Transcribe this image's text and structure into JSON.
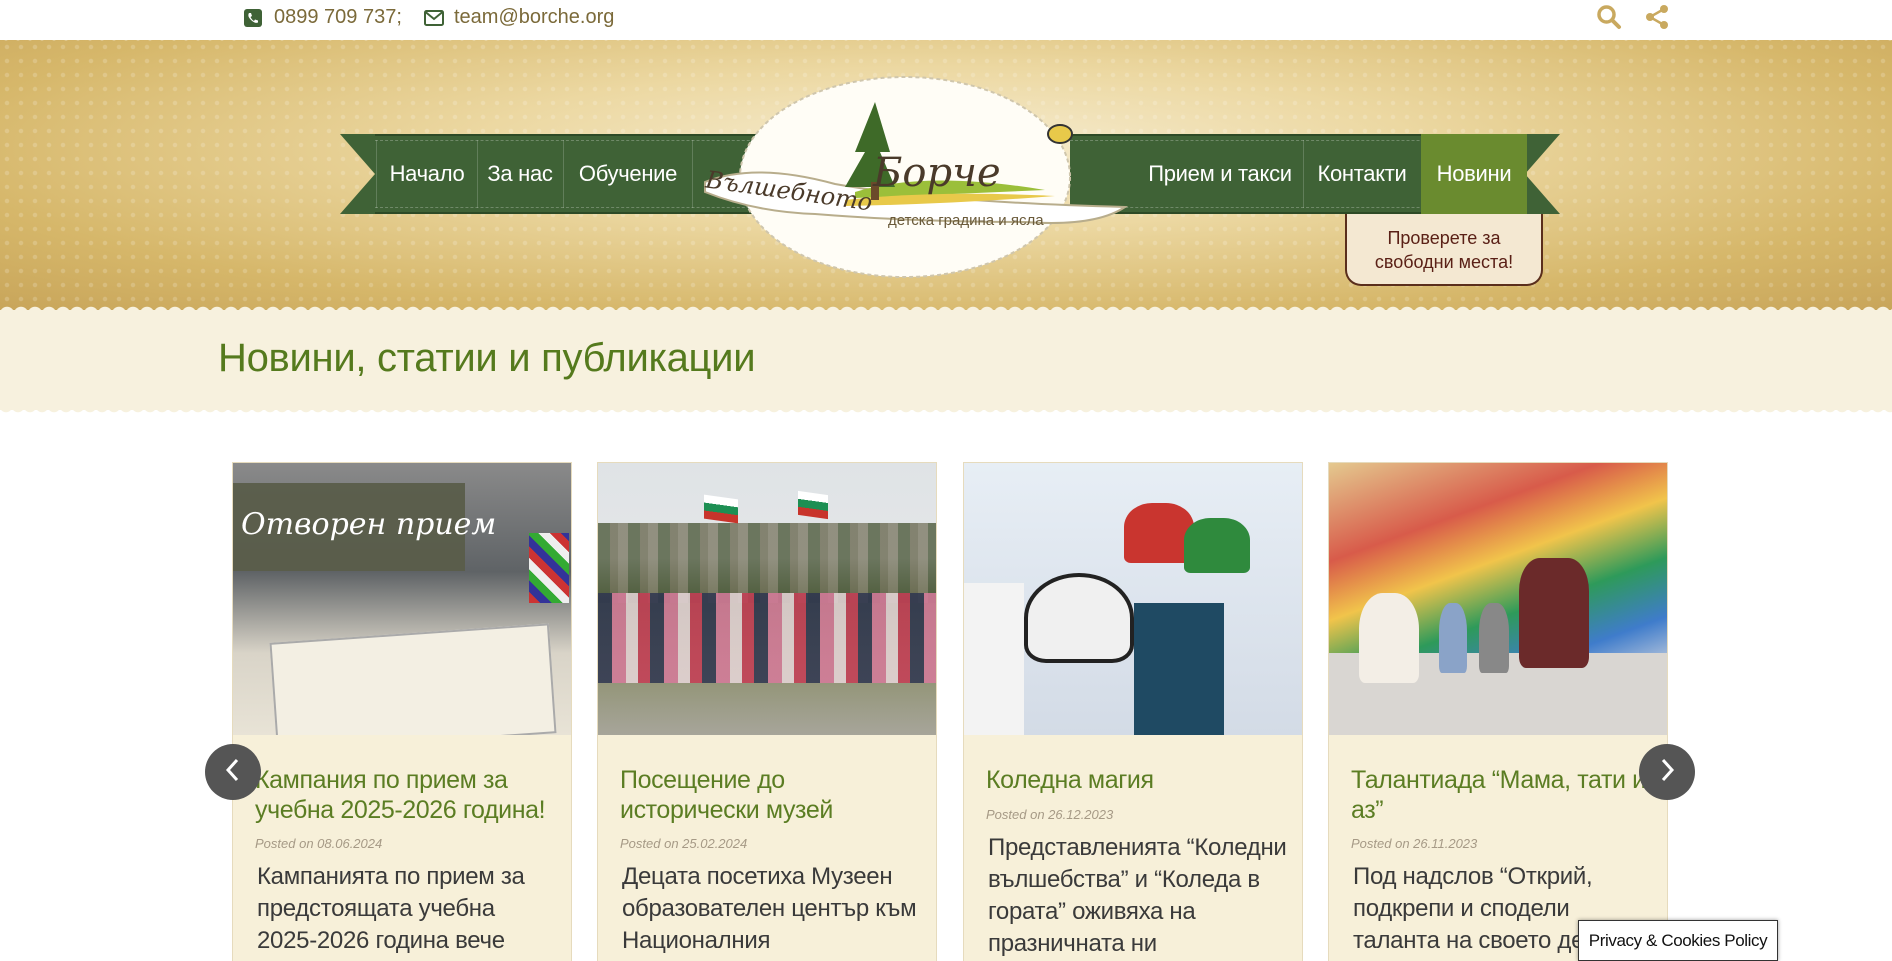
{
  "topbar": {
    "phone": "0899 709 737;",
    "email": "team@borche.org",
    "search_icon": "search-icon",
    "share_icon": "share-icon"
  },
  "nav": {
    "items": [
      {
        "label": "Начало"
      },
      {
        "label": "За нас"
      },
      {
        "label": "Обучение"
      },
      {
        "label": "Прием и такси"
      },
      {
        "label": "Контакти"
      },
      {
        "label": "Новини",
        "active": true
      }
    ],
    "cta": "Проверете за свободни места!"
  },
  "logo": {
    "name_script": "Вълшебното",
    "name_main": "Борче",
    "subtitle": "детска градина и ясла"
  },
  "page": {
    "title": "Новини, статии и публикации"
  },
  "posts": [
    {
      "image_caption": "Отворен прием",
      "title": "Кампания по прием за учебна 2025-2026 година!",
      "date": "Posted on 08.06.2024",
      "excerpt": "Кампанията по прием за предстоящата учебна 2025-2026 година вече"
    },
    {
      "title": "Посещение до исторически музей",
      "date": "Posted on 25.02.2024",
      "excerpt": "Децата посетиха Музеен образователен център към Националния"
    },
    {
      "title": "Коледна магия",
      "date": "Posted on 26.12.2023",
      "excerpt": "Представленията “Коледни вълшебства” и “Коледа в гората” оживяха на празничната ни"
    },
    {
      "title": "Талантиада “Мама, тати и аз”",
      "date": "Posted on 26.11.2023",
      "excerpt": "Под надслов “Открий, подкрепи и сподели таланта на своето де"
    }
  ],
  "carousel": {
    "prev_icon": "chevron-left-icon",
    "next_icon": "chevron-right-icon"
  },
  "privacy": {
    "label": "Privacy & Cookies Policy"
  },
  "colors": {
    "ribbon_green": "#3f6236",
    "active_green": "#6a8b2f",
    "title_green": "#557a1d",
    "gold": "#c9a95f",
    "cream": "#f7f1de"
  }
}
